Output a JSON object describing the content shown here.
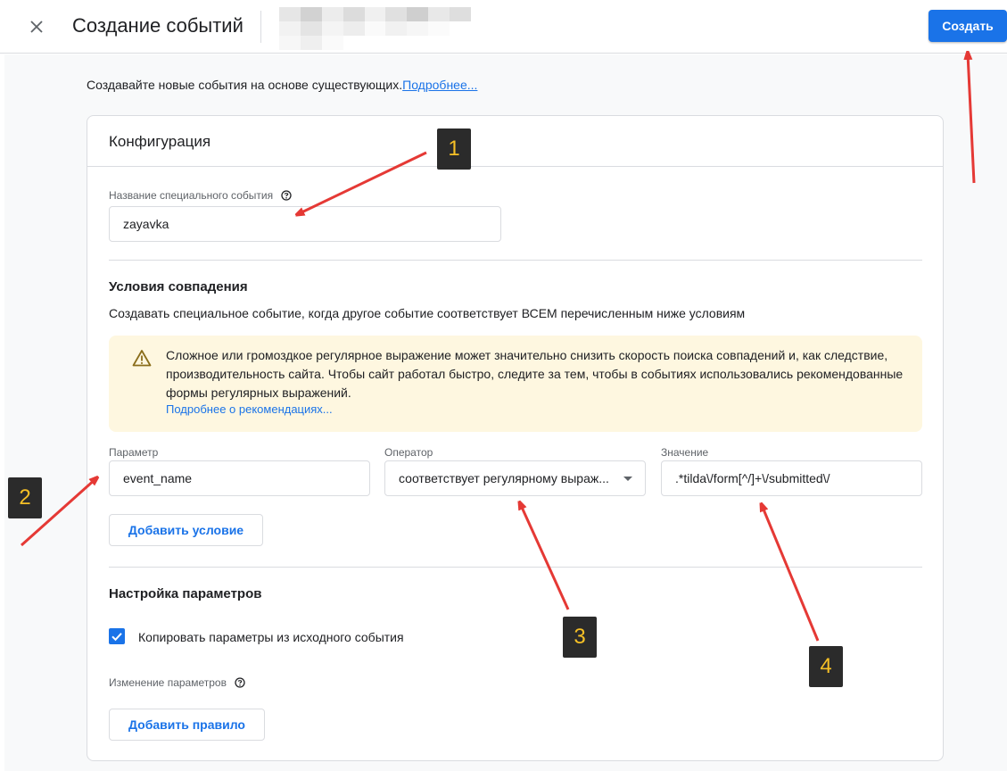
{
  "header": {
    "title": "Создание событий",
    "create_label": "Создать"
  },
  "intro": {
    "text": "Создавайте новые события на основе существующих.",
    "link": "Подробнее..."
  },
  "config": {
    "title": "Конфигурация",
    "event_name_label": "Название специального события",
    "event_name_value": "zayavka"
  },
  "match": {
    "title": "Условия совпадения",
    "description": "Создавать специальное событие, когда другое событие соответствует ВСЕМ перечисленным ниже условиям",
    "warning_text": "Сложное или громоздкое регулярное выражение может значительно снизить скорость поиска совпадений и, как следствие, производительность сайта. Чтобы сайт работал быстро, следите за тем, чтобы в событиях использовались рекомендованные формы регулярных выражений.",
    "warning_link": "Подробнее о рекомендациях...",
    "param_label": "Параметр",
    "param_value": "event_name",
    "operator_label": "Оператор",
    "operator_value": "соответствует регулярному выраж...",
    "value_label": "Значение",
    "value_value": ".*tilda\\/form[^/]+\\/submitted\\/",
    "add_condition": "Добавить условие"
  },
  "params": {
    "title": "Настройка параметров",
    "copy_label": "Копировать параметры из исходного события",
    "copy_checked": true,
    "modify_label": "Изменение параметров",
    "add_rule": "Добавить правило"
  },
  "annotations": {
    "badges": [
      "1",
      "2",
      "3",
      "4"
    ],
    "arrow_color": "#e53935",
    "badge_text_color": "#f6c026"
  },
  "colors": {
    "accent": "#1a73e8",
    "warning_bg": "#fef7e0"
  }
}
